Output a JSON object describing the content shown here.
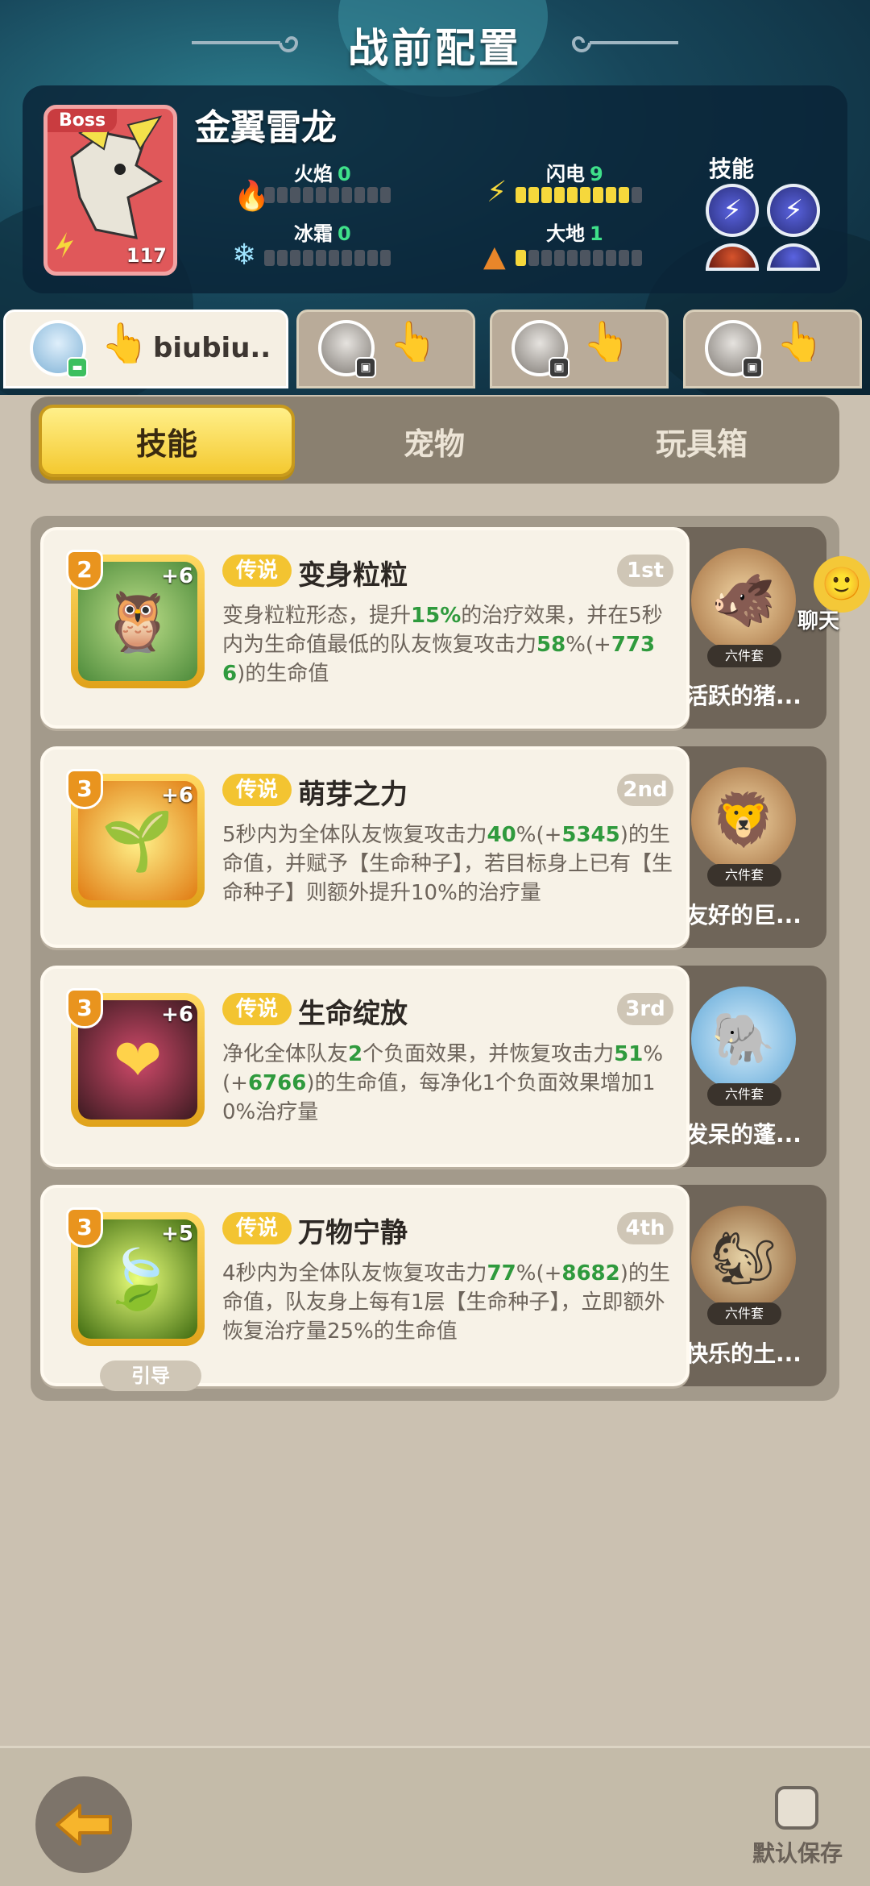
{
  "title": "战前配置",
  "boss": {
    "badge": "Boss",
    "level": "117",
    "name": "金翼雷龙",
    "stats": [
      {
        "label": "火焰",
        "value": "0",
        "filled": 0,
        "icon": "fire-icon"
      },
      {
        "label": "闪电",
        "value": "9",
        "filled": 9,
        "icon": "lightning-icon"
      },
      {
        "label": "冰霜",
        "value": "0",
        "filled": 0,
        "icon": "frost-icon"
      },
      {
        "label": "大地",
        "value": "1",
        "filled": 1,
        "icon": "earth-icon"
      }
    ],
    "skills_label": "技能"
  },
  "players": [
    {
      "name": "biubiu..",
      "active": true
    },
    {
      "name": "",
      "active": false
    },
    {
      "name": "",
      "active": false
    },
    {
      "name": "",
      "active": false
    }
  ],
  "tabs": [
    "技能",
    "宠物",
    "玩具箱"
  ],
  "skills": [
    {
      "level": "2",
      "plus": "+6",
      "rarity": "传说",
      "name": "变身粒粒",
      "rank": "1st",
      "desc": [
        [
          "变身粒粒形态，提升",
          ""
        ],
        [
          "15%",
          "g"
        ],
        [
          "的治疗效果，并在5秒内为生命值最低的队友恢复攻击力",
          ""
        ],
        [
          "58",
          "g"
        ],
        [
          "%(+",
          ""
        ],
        [
          "7736",
          "g"
        ],
        [
          ")的生命值",
          ""
        ]
      ],
      "pet": "活跃的猪...",
      "pet_tag": "六件套",
      "guide": ""
    },
    {
      "level": "3",
      "plus": "+6",
      "rarity": "传说",
      "name": "萌芽之力",
      "rank": "2nd",
      "desc": [
        [
          "5秒内为全体队友恢复攻击力",
          ""
        ],
        [
          "40",
          "g"
        ],
        [
          "%(+",
          ""
        ],
        [
          "5345",
          "g"
        ],
        [
          ")的生命值，并赋予【生命种子】，若目标身上已有【生命种子】则额外提升10%的治疗量",
          ""
        ]
      ],
      "pet": "友好的巨...",
      "pet_tag": "六件套",
      "guide": ""
    },
    {
      "level": "3",
      "plus": "+6",
      "rarity": "传说",
      "name": "生命绽放",
      "rank": "3rd",
      "desc": [
        [
          "净化全体队友",
          ""
        ],
        [
          "2",
          "g"
        ],
        [
          "个负面效果，并恢复攻击力",
          ""
        ],
        [
          "51",
          "g"
        ],
        [
          "%(+",
          ""
        ],
        [
          "6766",
          "g"
        ],
        [
          ")的生命值，每净化1个负面效果增加10%治疗量",
          ""
        ]
      ],
      "pet": "发呆的蓬...",
      "pet_tag": "六件套",
      "guide": ""
    },
    {
      "level": "3",
      "plus": "+5",
      "rarity": "传说",
      "name": "万物宁静",
      "rank": "4th",
      "desc": [
        [
          "4秒内为全体队友恢复攻击力",
          ""
        ],
        [
          "77",
          "g"
        ],
        [
          "%(+",
          ""
        ],
        [
          "8682",
          "g"
        ],
        [
          ")的生命值，队友身上每有1层【生命种子】，立即额外恢复治疗量25%的生命值",
          ""
        ]
      ],
      "pet": "快乐的土...",
      "pet_tag": "六件套",
      "guide": "引导"
    }
  ],
  "chat_label": "聊天",
  "footer": {
    "save_label": "默认保存"
  },
  "colors": {
    "accent": "#f4c930",
    "green_value": "#2f9a3d",
    "header_bg": "#17465a"
  }
}
